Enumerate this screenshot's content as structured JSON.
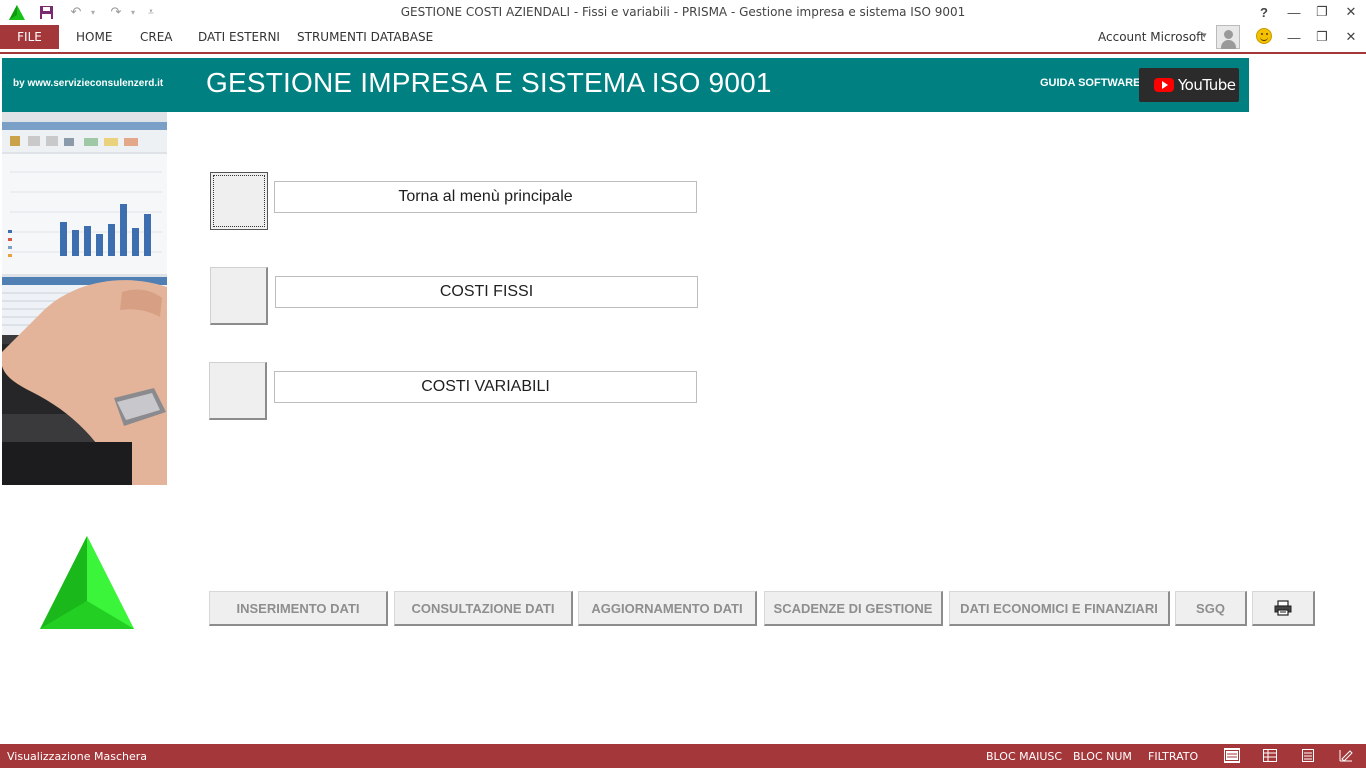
{
  "window": {
    "title": "GESTIONE COSTI AZIENDALI - Fissi e variabili - PRISMA - Gestione impresa e sistema ISO 9001",
    "help_label": "?",
    "minimize_label": "—",
    "restore_label": "❐",
    "close_label": "✕"
  },
  "quick_access": {
    "app_icon": "prisma-triangle-icon",
    "save_icon": "save-icon",
    "undo_icon": "undo-icon",
    "redo_icon": "redo-icon",
    "customize_icon": "customize-caret-icon"
  },
  "ribbon": {
    "file": "FILE",
    "tabs": [
      "HOME",
      "CREA",
      "DATI ESTERNI",
      "STRUMENTI DATABASE"
    ],
    "account": "Account Microsoft"
  },
  "header": {
    "byline": "by www.servizieconsulenzerd.it",
    "title": "GESTIONE IMPRESA E SISTEMA ISO 9001",
    "guide": "GUIDA SOFTWARE",
    "youtube": "YouTube"
  },
  "menu": [
    {
      "label": "Torna al menù principale"
    },
    {
      "label": "COSTI FISSI"
    },
    {
      "label": "COSTI VARIABILI"
    }
  ],
  "nav": {
    "buttons": [
      "INSERIMENTO DATI",
      "CONSULTAZIONE DATI",
      "AGGIORNAMENTO DATI",
      "SCADENZE DI GESTIONE",
      "DATI ECONOMICI E FINANZIARI",
      "SGQ"
    ],
    "print_icon": "printer-icon"
  },
  "status": {
    "view": "Visualizzazione Maschera",
    "caps": "BLOC MAIUSC",
    "num": "BLOC NUM",
    "filter": "FILTRATO"
  },
  "colors": {
    "accent": "#a4373a",
    "header": "#008080",
    "logo_green": "#22dd22"
  }
}
